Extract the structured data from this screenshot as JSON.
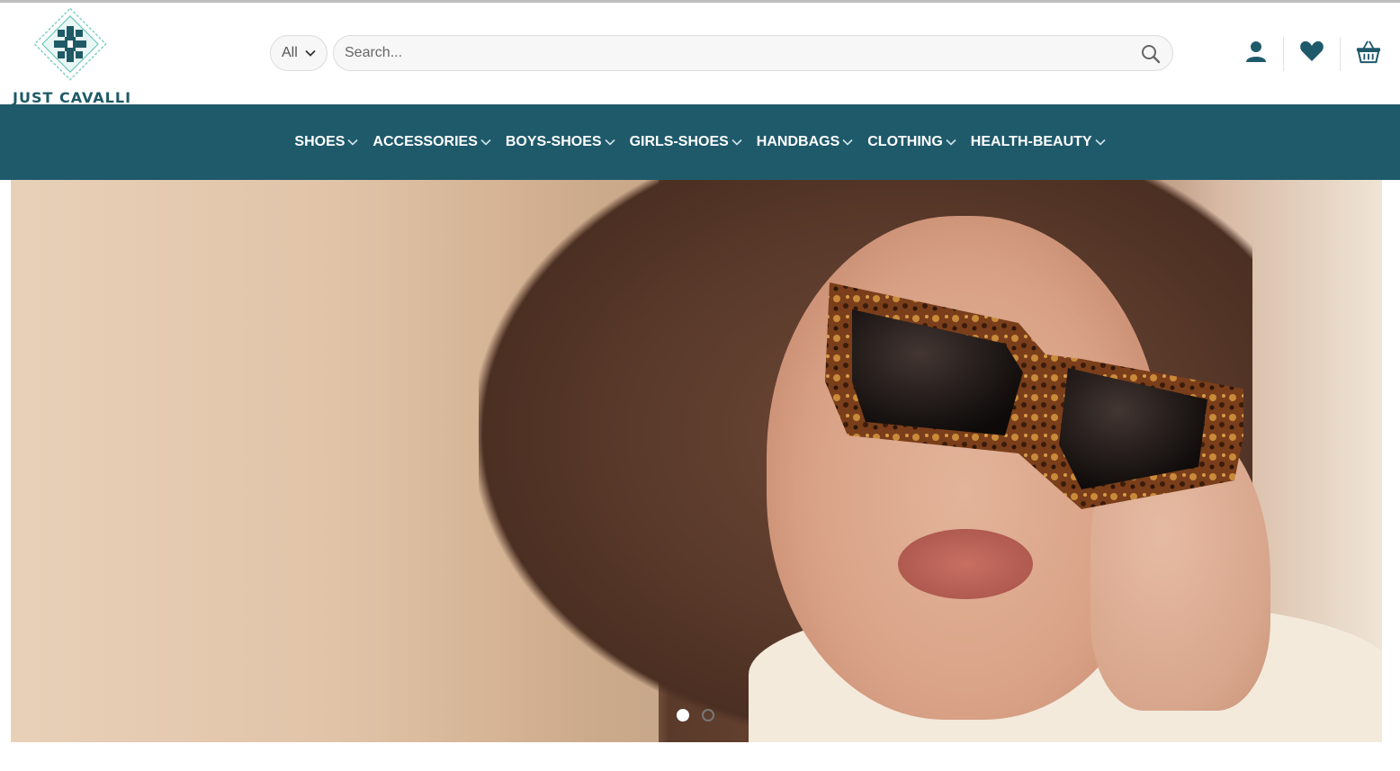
{
  "brand": {
    "name": "JUST CAVALLI"
  },
  "search": {
    "category_label": "All",
    "placeholder": "Search..."
  },
  "header_icons": [
    "user-icon",
    "heart-icon",
    "basket-icon"
  ],
  "nav": {
    "items": [
      {
        "label": "SHOES"
      },
      {
        "label": "ACCESSORIES"
      },
      {
        "label": "BOYS-SHOES"
      },
      {
        "label": "GIRLS-SHOES"
      },
      {
        "label": "HANDBAGS"
      },
      {
        "label": "CLOTHING"
      },
      {
        "label": "HEALTH-BEAUTY"
      }
    ]
  },
  "colors": {
    "brand_teal": "#1f5a6b",
    "logo_teal": "#1f5a66",
    "logo_accent": "#59c2b1"
  },
  "slider": {
    "slides": 2,
    "active_index": 0
  }
}
